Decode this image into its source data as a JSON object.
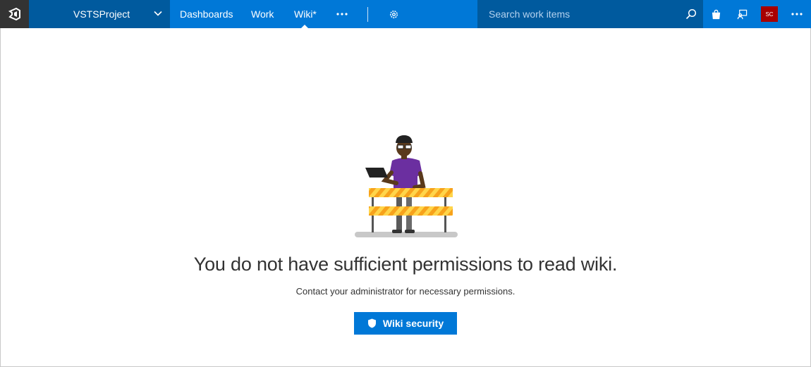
{
  "header": {
    "project_name": "VSTSProject",
    "nav": [
      {
        "label": "Dashboards"
      },
      {
        "label": "Work"
      },
      {
        "label": "Wiki*"
      }
    ],
    "search_placeholder": "Search work items",
    "avatar_initials": "SC"
  },
  "main": {
    "title": "You do not have sufficient permissions to read wiki.",
    "subtitle": "Contact your administrator for necessary permissions.",
    "button_label": "Wiki security"
  },
  "colors": {
    "topbar": "#0078d7",
    "topbar_dark": "#005a9e",
    "logo_bg": "#333333",
    "avatar": "#a80000",
    "primary_button": "#0078d7"
  },
  "icons": [
    "vsts-logo-icon",
    "chevron-down-icon",
    "more-icon",
    "gear-icon",
    "search-icon",
    "marketplace-bag-icon",
    "feedback-icon",
    "more-icon",
    "shield-icon"
  ]
}
